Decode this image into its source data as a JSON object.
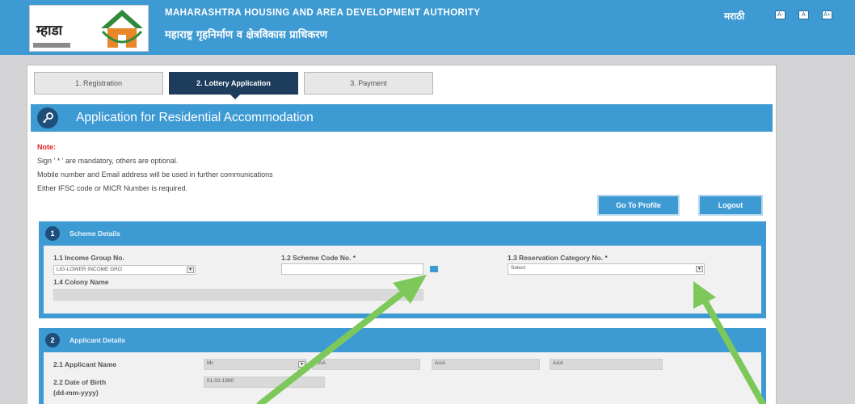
{
  "header": {
    "logo_text": "म्हाडा",
    "org_name_en": "MAHARASHTRA HOUSING AND AREA DEVELOPMENT AUTHORITY",
    "org_name_mr": "महाराष्ट्र गृहनिर्माण व क्षेत्रविकास प्राधिकरण",
    "language_link": "मराठी",
    "font_size_controls": [
      "A-",
      "A",
      "A+"
    ]
  },
  "tabs": [
    {
      "label": "1. Registration",
      "active": false
    },
    {
      "label": "2. Lottery Application",
      "active": true
    },
    {
      "label": "3. Payment",
      "active": false
    }
  ],
  "page_title": "Application for Residential Accommodation",
  "note": {
    "label": "Note:",
    "lines": [
      "Sign ' * ' are mandatory, others are optional.",
      "Mobile number and Email address will be used in further communications",
      "Either IFSC code or MICR Number is required."
    ]
  },
  "buttons": {
    "go_to_profile": "Go To Profile",
    "logout": "Logout"
  },
  "scheme_details": {
    "number": "1",
    "title": "Scheme Details",
    "income_group_label": "1.1 Income Group No.",
    "income_group_value": "LIG-LOWER INCOME GRO",
    "scheme_code_label": "1.2 Scheme Code No. *",
    "scheme_code_value": "",
    "reservation_label": "1.3 Reservation Category No. *",
    "reservation_value": "Select",
    "colony_label": "1.4 Colony Name",
    "colony_value": ""
  },
  "applicant_details": {
    "number": "2",
    "title": "Applicant Details",
    "name_label": "2.1 Applicant Name",
    "name_title": "Mr.",
    "first_name": "AAA",
    "middle_name": "AAA",
    "last_name": "AAA",
    "dob_label_line1": "2.2 Date of Birth",
    "dob_label_line2": "(dd-mm-yyyy)",
    "dob_value": "01-02-1990"
  },
  "colors": {
    "header_blue": "#3d9ad3",
    "tab_active": "#1e3d5c",
    "note_red": "#e02424",
    "arrow_green": "#7dc85a"
  }
}
